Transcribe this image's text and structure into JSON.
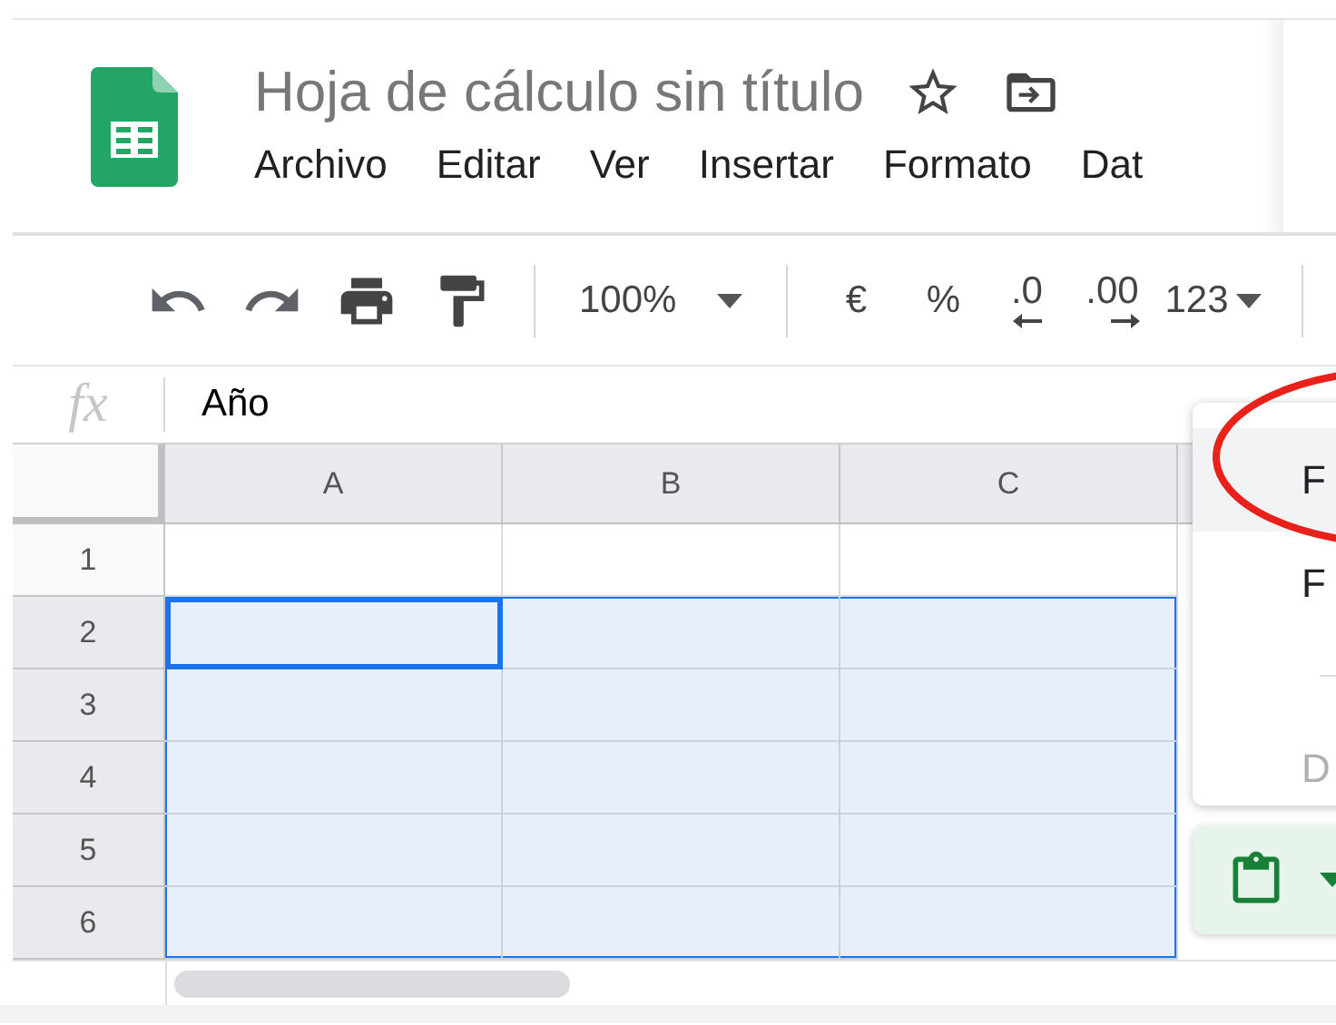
{
  "document": {
    "title": "Hoja de cálculo sin título"
  },
  "menu_bar": [
    "Archivo",
    "Editar",
    "Ver",
    "Insertar",
    "Formato",
    "Dat"
  ],
  "toolbar": {
    "zoom": "100%",
    "currency": "€",
    "percent": "%",
    "decrease_decimals": ".0",
    "increase_decimals": ".00",
    "more_formats": "123"
  },
  "formula_bar": {
    "label": "fx",
    "value": "Año"
  },
  "grid": {
    "columns": [
      "A",
      "B",
      "C"
    ],
    "rows": [
      {
        "label": "1",
        "selected": false,
        "cells": [
          {
            "selected": false,
            "active": false
          },
          {
            "selected": false,
            "active": false
          },
          {
            "selected": false,
            "active": false
          }
        ]
      },
      {
        "label": "2",
        "selected": true,
        "cells": [
          {
            "selected": true,
            "active": true
          },
          {
            "selected": true,
            "active": false
          },
          {
            "selected": true,
            "active": false
          }
        ]
      },
      {
        "label": "3",
        "selected": true,
        "cells": [
          {
            "selected": true,
            "active": false
          },
          {
            "selected": true,
            "active": false
          },
          {
            "selected": true,
            "active": false
          }
        ]
      },
      {
        "label": "4",
        "selected": true,
        "cells": [
          {
            "selected": true,
            "active": false
          },
          {
            "selected": true,
            "active": false
          },
          {
            "selected": true,
            "active": false
          }
        ]
      },
      {
        "label": "5",
        "selected": true,
        "cells": [
          {
            "selected": true,
            "active": false
          },
          {
            "selected": true,
            "active": false
          },
          {
            "selected": true,
            "active": false
          }
        ]
      },
      {
        "label": "6",
        "selected": true,
        "cells": [
          {
            "selected": true,
            "active": false
          },
          {
            "selected": true,
            "active": false
          },
          {
            "selected": true,
            "active": false
          }
        ]
      }
    ]
  },
  "context_menu": {
    "items": [
      {
        "kind": "item",
        "label": "F",
        "selected": true,
        "disabled": false
      },
      {
        "kind": "item",
        "label": "F",
        "selected": false,
        "disabled": false
      },
      {
        "kind": "divider"
      },
      {
        "kind": "item",
        "label": "D",
        "selected": false,
        "disabled": true
      }
    ]
  }
}
